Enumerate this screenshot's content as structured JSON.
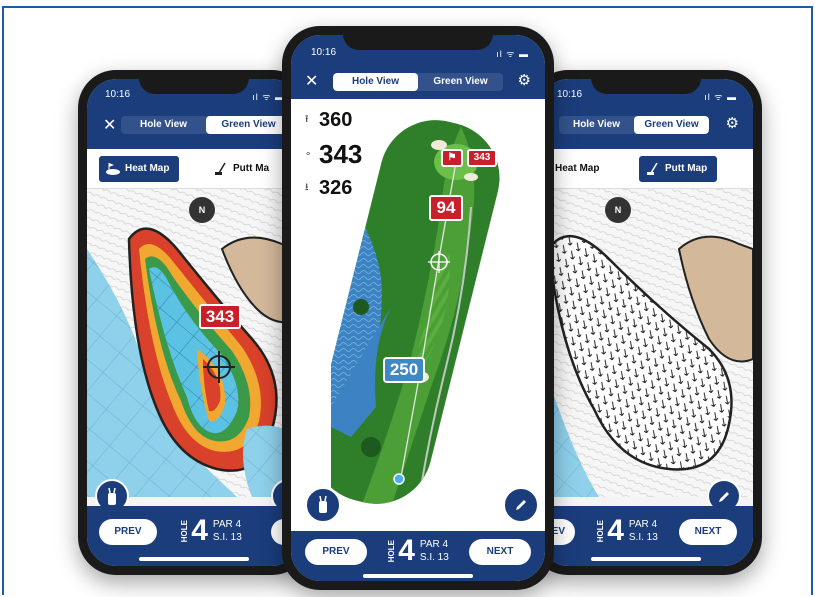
{
  "status": {
    "time": "10:16",
    "icons": "ıl ᯤ ▬"
  },
  "tabs": {
    "hole_view": "Hole View",
    "green_view": "Green View"
  },
  "map_tools": {
    "heat_map": "Heat Map",
    "putt_map": "Putt Map",
    "putt_map_short": "Putt Ma"
  },
  "compass": "N",
  "hole": {
    "vertical_label": "HOLE",
    "number": "4",
    "par": "PAR 4",
    "si": "S.I. 13"
  },
  "nav": {
    "prev": "PREV",
    "next": "NEXT",
    "prev_short": "EV",
    "next_short": "NE"
  },
  "distances": {
    "back": "360",
    "middle": "343",
    "front": "326"
  },
  "markers": {
    "flag_distance": "343",
    "layup_distance": "94",
    "tee_distance": "250",
    "heat_distance": "343"
  },
  "icons": [
    "close-icon",
    "gear-icon",
    "golf-bag-icon",
    "pencil-icon",
    "compass-icon",
    "flag-icon",
    "crosshair-icon"
  ],
  "colors": {
    "navy": "#1b3d7c",
    "red_badge": "#c8202a",
    "blue_badge": "#3f88c6",
    "fairway": "#3d8f2d",
    "water": "#4a8fc8"
  }
}
